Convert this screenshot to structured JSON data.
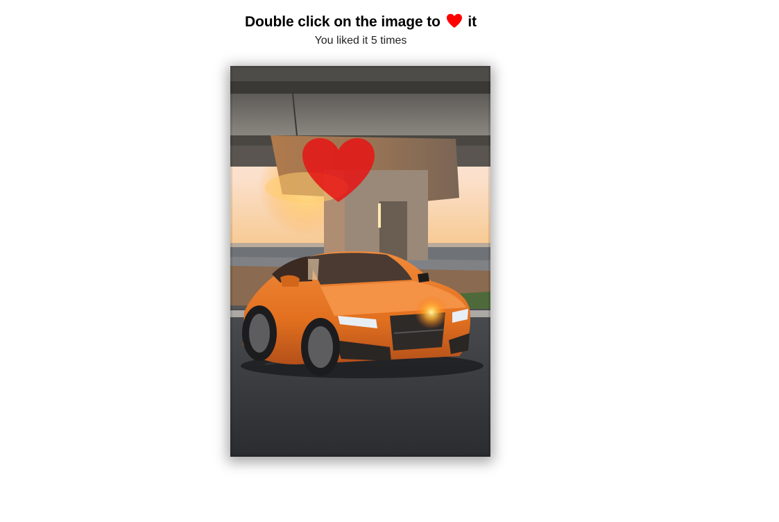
{
  "header": {
    "title_before": "Double click on the image to",
    "title_after": "it",
    "heart_icon": "heart-icon",
    "like_text_prefix": "You liked it",
    "like_count": "5",
    "like_text_suffix": "times"
  },
  "photo": {
    "subject": "orange-coupe-under-bridge-at-sunset",
    "overlay_icon": "heart-icon"
  },
  "colors": {
    "heart": "#ff0000",
    "heart_overlay": "rgba(230,20,20,0.85)",
    "car": "#e2701f",
    "sky": "#fde9d6",
    "text": "#000000"
  }
}
